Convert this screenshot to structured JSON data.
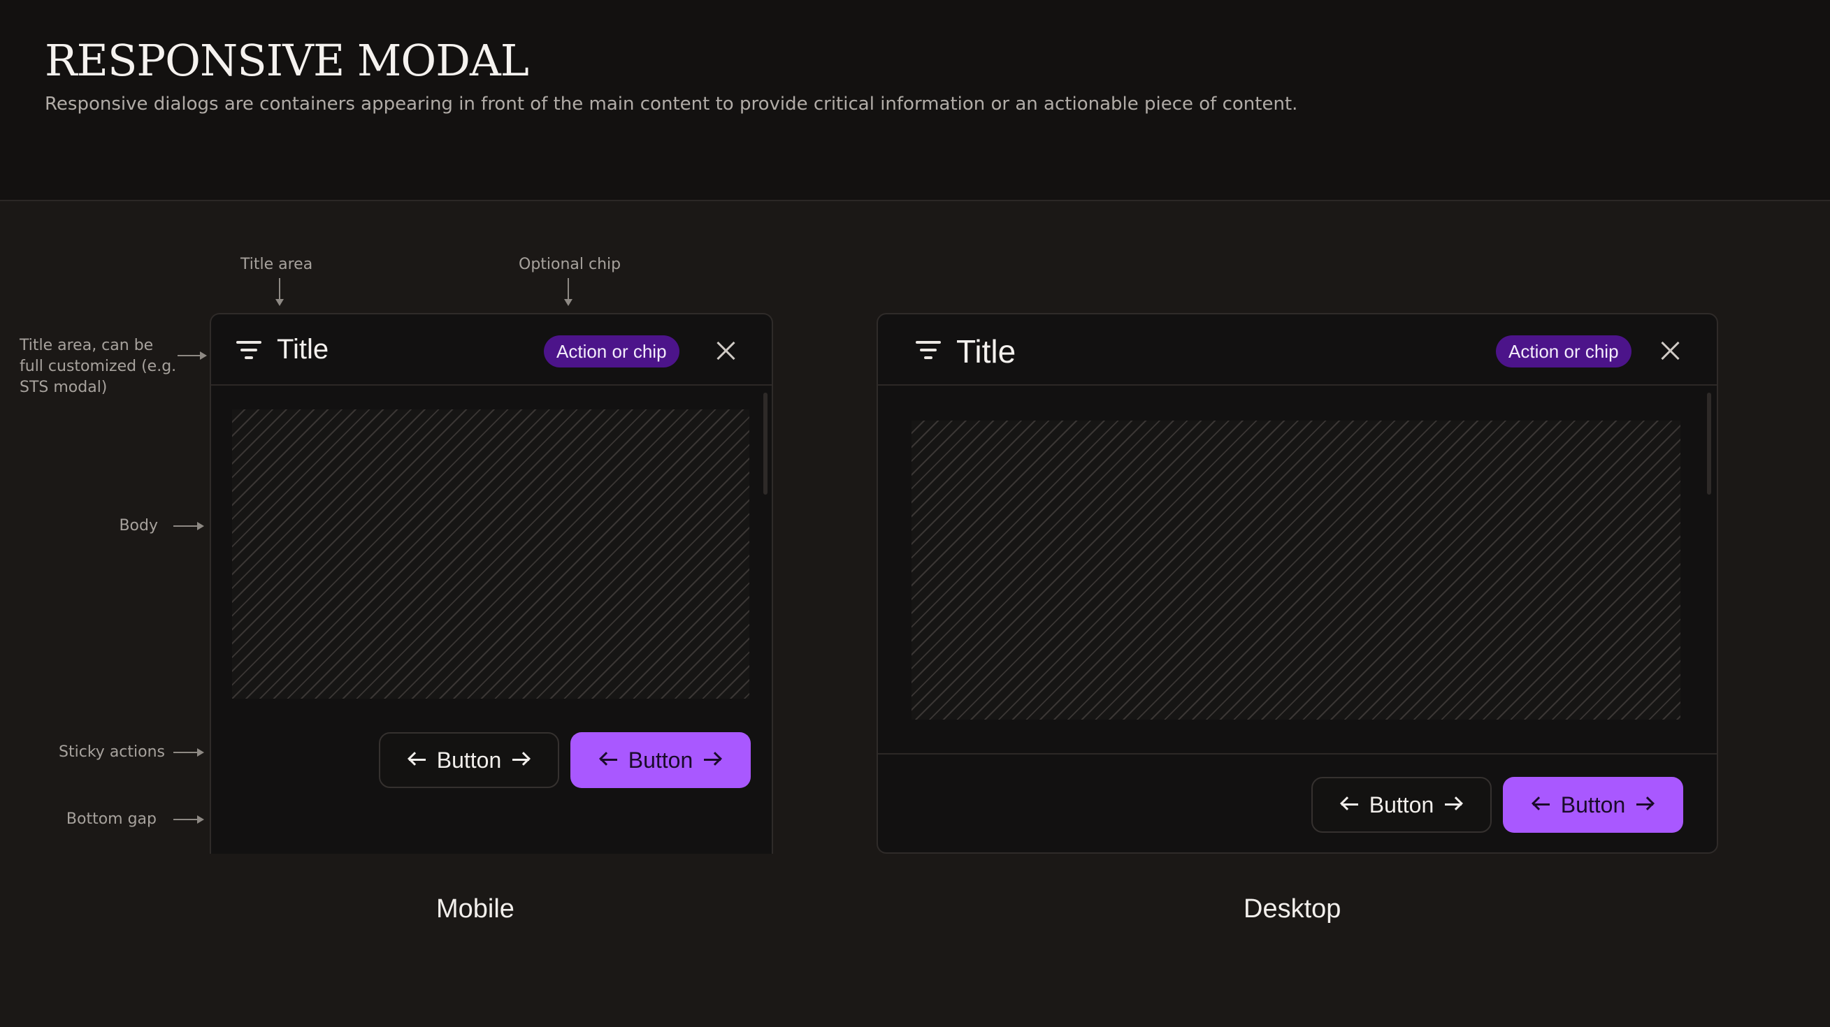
{
  "page": {
    "title": "RESPONSIVE MODAL",
    "description": "Responsive dialogs are containers appearing in front of the main content to provide critical information or an actionable piece of content."
  },
  "annotations": {
    "title_area_top": "Title area",
    "optional_chip": "Optional chip",
    "title_area_side": "Title area, can be full customized (e.g. STS modal)",
    "body": "Body",
    "sticky_actions": "Sticky actions",
    "bottom_gap": "Bottom gap"
  },
  "mobile": {
    "title": "Title",
    "chip": "Action or chip",
    "secondary_button": "Button",
    "primary_button": "Button",
    "caption": "Mobile"
  },
  "desktop": {
    "title": "Title",
    "chip": "Action or chip",
    "secondary_button": "Button",
    "primary_button": "Button",
    "caption": "Desktop"
  },
  "colors": {
    "background": "#1b1816",
    "header_background": "#131110",
    "modal_background": "#121111",
    "chip": "#4c148a",
    "primary_button": "#a958ff"
  },
  "icons": [
    "filter-icon",
    "close-icon",
    "arrow-left-icon",
    "arrow-right-icon"
  ]
}
